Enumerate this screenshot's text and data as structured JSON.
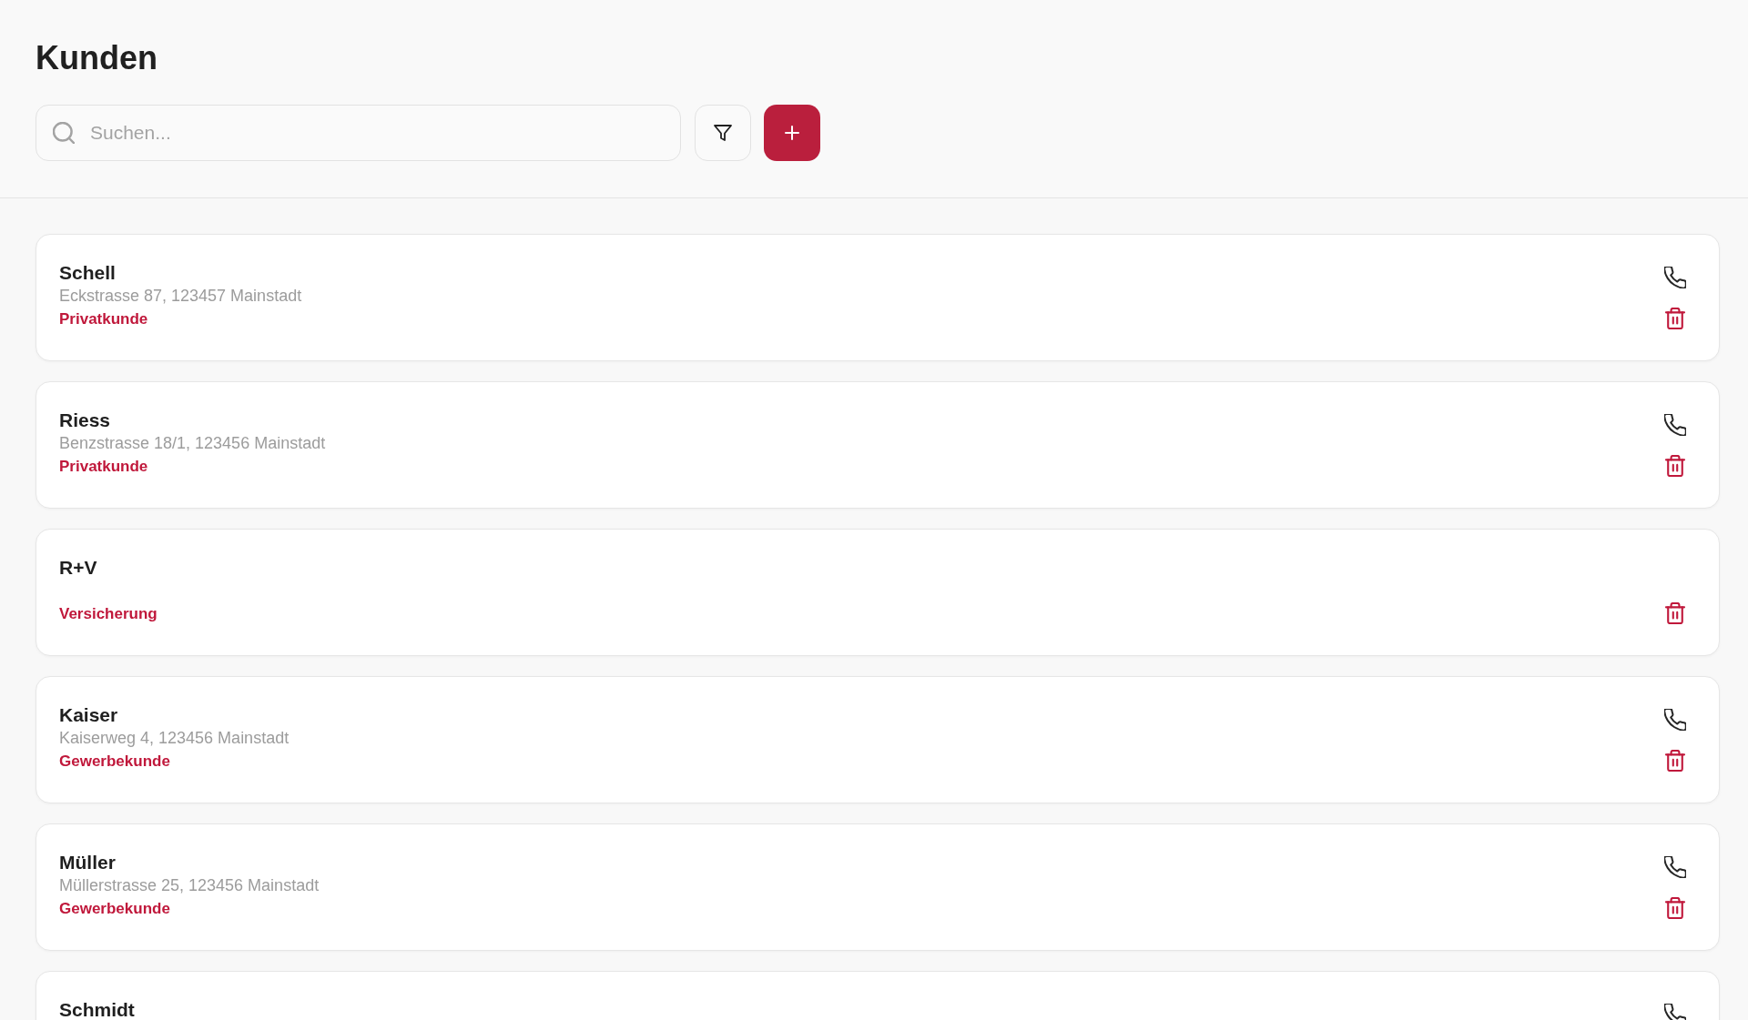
{
  "title": "Kunden",
  "search": {
    "placeholder": "Suchen..."
  },
  "customers": [
    {
      "name": "Schell",
      "address": "Eckstrasse 87, 123457 Mainstadt",
      "type": "Privatkunde",
      "actions": [
        {
          "kind": "call"
        },
        {
          "kind": "delete"
        }
      ]
    },
    {
      "name": "Riess",
      "address": "Benzstrasse 18/1, 123456 Mainstadt",
      "type": "Privatkunde",
      "actions": [
        {
          "kind": "call"
        },
        {
          "kind": "delete"
        }
      ]
    },
    {
      "name": "R+V",
      "type": "Versicherung",
      "actions": [
        {
          "kind": "delete"
        }
      ]
    },
    {
      "name": "Kaiser",
      "address": "Kaiserweg 4, 123456 Mainstadt",
      "type": "Gewerbekunde",
      "actions": [
        {
          "kind": "call"
        },
        {
          "kind": "delete"
        }
      ]
    },
    {
      "name": "Müller",
      "address": "Müllerstrasse 25, 123456 Mainstadt",
      "type": "Gewerbekunde",
      "actions": [
        {
          "kind": "call"
        },
        {
          "kind": "delete"
        }
      ]
    },
    {
      "name": "Schmidt",
      "actions": [
        {
          "kind": "call"
        }
      ]
    }
  ]
}
